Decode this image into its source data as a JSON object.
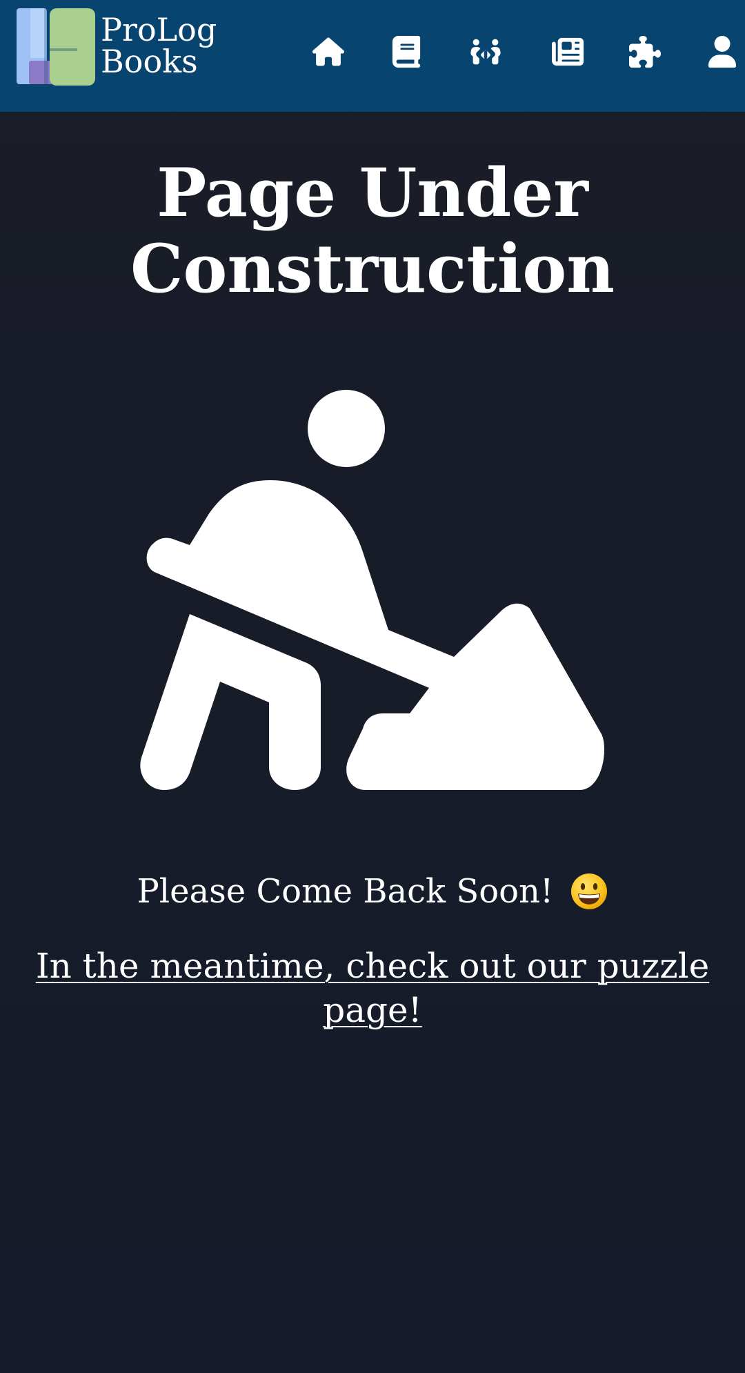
{
  "header": {
    "logo": {
      "line1": "ProLog",
      "line2": "Books",
      "icon": "prolog-books-logo"
    },
    "nav": [
      {
        "icon": "home-icon"
      },
      {
        "icon": "book-icon"
      },
      {
        "icon": "people-arrows-icon"
      },
      {
        "icon": "newspaper-icon"
      },
      {
        "icon": "puzzle-piece-icon"
      },
      {
        "icon": "user-icon"
      }
    ],
    "background_color": "#07446f"
  },
  "main": {
    "title": "Page Under Construction",
    "illustration": "person-digging-icon",
    "message": "Please Come Back Soon!",
    "emoji": "grinning-face-emoji",
    "link_text": "In the meantime, check out our puzzle page!"
  },
  "colors": {
    "header_bg": "#07446f",
    "page_bg": "#181c28",
    "text": "#ffffff",
    "logo_blue": "#9ec2f5",
    "logo_green": "#a9d08e",
    "logo_purple": "#8b7bc6"
  }
}
